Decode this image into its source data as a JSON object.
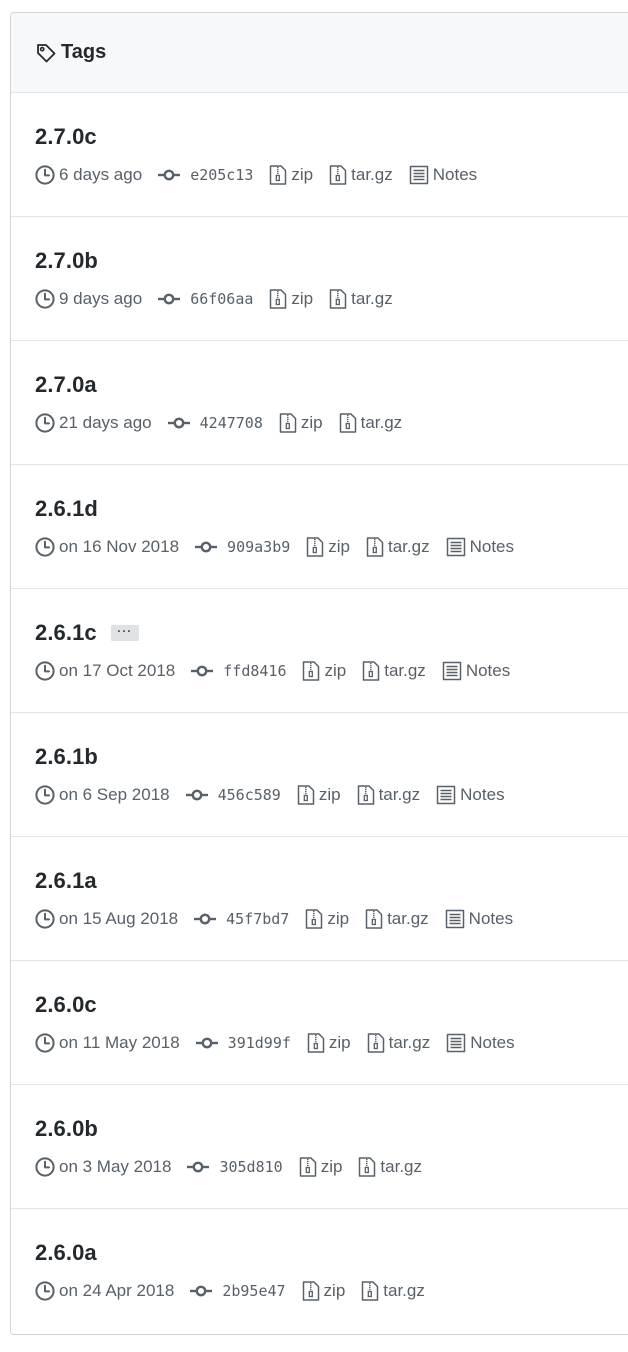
{
  "header": {
    "title": "Tags",
    "icon": "tag-icon"
  },
  "labels": {
    "zip": "zip",
    "targz": "tar.gz",
    "notes": "Notes",
    "ellipsis": "···"
  },
  "colors": {
    "header_bg": "#f6f8fa",
    "border": "#e1e4e8",
    "title_text": "#24292e",
    "meta_text": "#586069",
    "ellipsis_bg": "#dfe2e5"
  },
  "tags": [
    {
      "name": "2.7.0c",
      "date": "6 days ago",
      "sha": "e205c13",
      "has_notes": true,
      "has_ellipsis": false
    },
    {
      "name": "2.7.0b",
      "date": "9 days ago",
      "sha": "66f06aa",
      "has_notes": false,
      "has_ellipsis": false
    },
    {
      "name": "2.7.0a",
      "date": "21 days ago",
      "sha": "4247708",
      "has_notes": false,
      "has_ellipsis": false
    },
    {
      "name": "2.6.1d",
      "date": "on 16 Nov 2018",
      "sha": "909a3b9",
      "has_notes": true,
      "has_ellipsis": false
    },
    {
      "name": "2.6.1c",
      "date": "on 17 Oct 2018",
      "sha": "ffd8416",
      "has_notes": true,
      "has_ellipsis": true
    },
    {
      "name": "2.6.1b",
      "date": "on 6 Sep 2018",
      "sha": "456c589",
      "has_notes": true,
      "has_ellipsis": false
    },
    {
      "name": "2.6.1a",
      "date": "on 15 Aug 2018",
      "sha": "45f7bd7",
      "has_notes": true,
      "has_ellipsis": false
    },
    {
      "name": "2.6.0c",
      "date": "on 11 May 2018",
      "sha": "391d99f",
      "has_notes": true,
      "has_ellipsis": false
    },
    {
      "name": "2.6.0b",
      "date": "on 3 May 2018",
      "sha": "305d810",
      "has_notes": false,
      "has_ellipsis": false
    },
    {
      "name": "2.6.0a",
      "date": "on 24 Apr 2018",
      "sha": "2b95e47",
      "has_notes": false,
      "has_ellipsis": false
    }
  ]
}
